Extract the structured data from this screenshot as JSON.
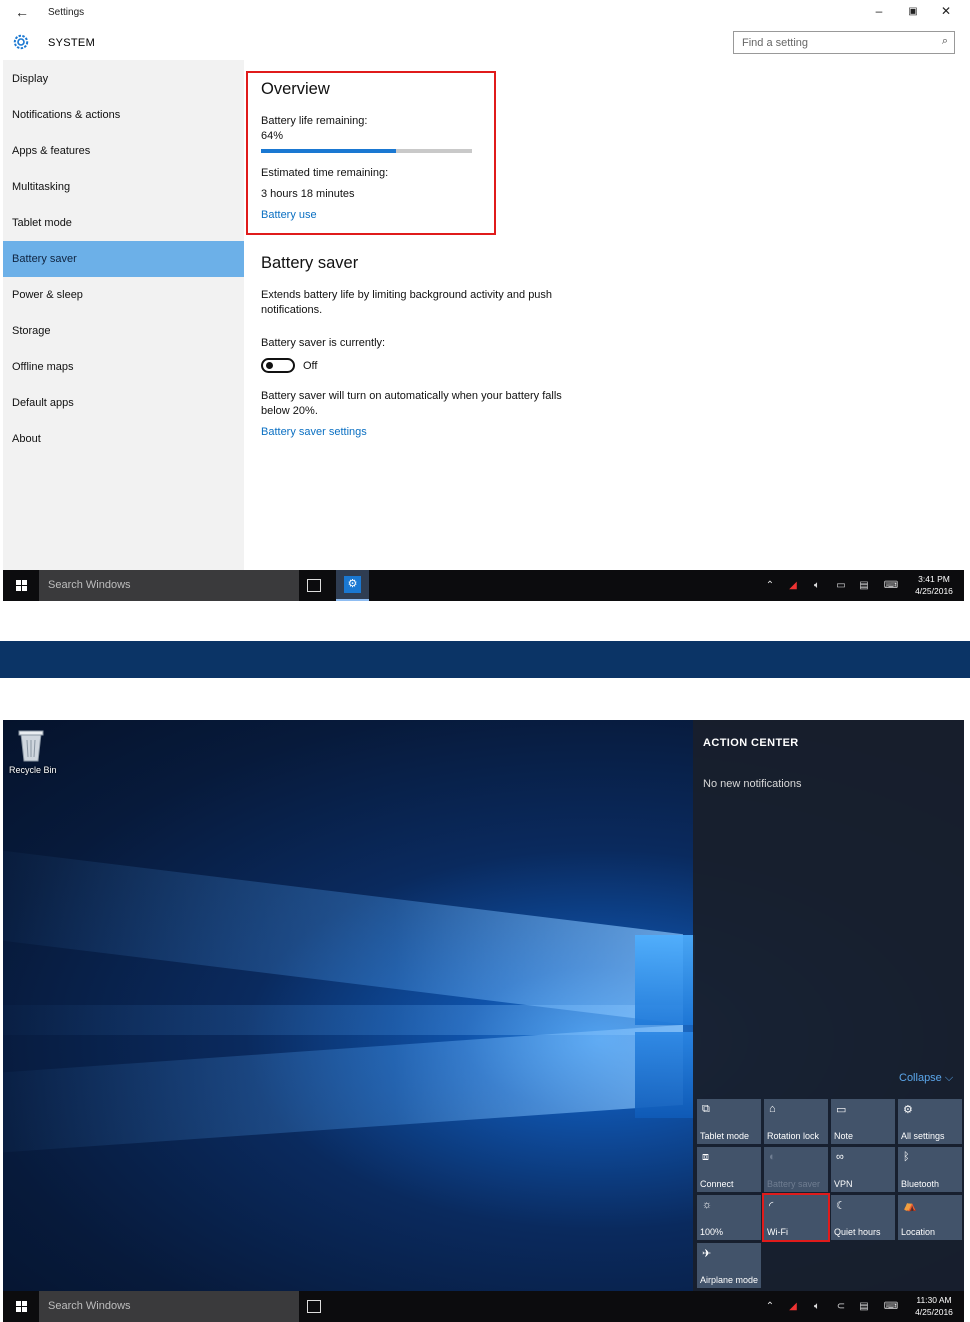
{
  "settings": {
    "title": "Settings",
    "section": "SYSTEM",
    "search_placeholder": "Find a setting",
    "nav": [
      {
        "label": "Display"
      },
      {
        "label": "Notifications & actions"
      },
      {
        "label": "Apps & features"
      },
      {
        "label": "Multitasking"
      },
      {
        "label": "Tablet mode"
      },
      {
        "label": "Battery saver",
        "selected": true
      },
      {
        "label": "Power & sleep"
      },
      {
        "label": "Storage"
      },
      {
        "label": "Offline maps"
      },
      {
        "label": "Default apps"
      },
      {
        "label": "About"
      }
    ],
    "overview": {
      "heading": "Overview",
      "battery_life_label": "Battery life remaining:",
      "battery_life_value": "64%",
      "battery_fraction": 0.64,
      "estimated_label": "Estimated time remaining:",
      "estimated_value": "3 hours 18 minutes",
      "battery_use_link": "Battery use"
    },
    "battery_saver": {
      "heading": "Battery saver",
      "description_line1": "Extends battery life by limiting background activity and push",
      "description_line2": "notifications.",
      "status_label": "Battery saver is currently:",
      "toggle_state": "Off",
      "auto_line1": "Battery saver will turn on automatically when your battery falls",
      "auto_line2": "below 20%.",
      "settings_link": "Battery saver settings"
    }
  },
  "taskbar_top": {
    "search_placeholder": "Search Windows",
    "time": "3:41 PM",
    "date": "4/25/2016"
  },
  "desktop": {
    "recycle_bin_label": "Recycle Bin"
  },
  "action_center": {
    "title": "ACTION CENTER",
    "empty_message": "No new notifications",
    "collapse_label": "Collapse",
    "tiles": [
      {
        "label": "Tablet mode",
        "icon": "tablet-mode-icon",
        "glyph": "⧉"
      },
      {
        "label": "Rotation lock",
        "icon": "rotation-lock-icon",
        "glyph": "⌂"
      },
      {
        "label": "Note",
        "icon": "note-icon",
        "glyph": "▭"
      },
      {
        "label": "All settings",
        "icon": "gear-icon",
        "glyph": "⚙"
      },
      {
        "label": "Connect",
        "icon": "connect-icon",
        "glyph": "⧈"
      },
      {
        "label": "Battery saver",
        "icon": "battery-saver-icon",
        "glyph": "◐",
        "disabled": true
      },
      {
        "label": "VPN",
        "icon": "vpn-icon",
        "glyph": "∞"
      },
      {
        "label": "Bluetooth",
        "icon": "bluetooth-icon",
        "glyph": "ᛒ"
      },
      {
        "label": "100%",
        "icon": "brightness-icon",
        "glyph": "☼"
      },
      {
        "label": "Wi-Fi",
        "icon": "wifi-icon",
        "glyph": "◜",
        "highlighted": true
      },
      {
        "label": "Quiet hours",
        "icon": "moon-icon",
        "glyph": "☾"
      },
      {
        "label": "Location",
        "icon": "location-icon",
        "glyph": "⛺"
      },
      {
        "label": "Airplane mode",
        "icon": "airplane-icon",
        "glyph": "✈"
      }
    ]
  },
  "taskbar_bottom": {
    "search_placeholder": "Search Windows",
    "time": "11:30 AM",
    "date": "4/25/2016"
  },
  "colors": {
    "accent": "#1a78d2",
    "nav_selected": "#6cb0e8",
    "highlight_box": "#e01b1b",
    "divider_bar": "#0b3466"
  }
}
